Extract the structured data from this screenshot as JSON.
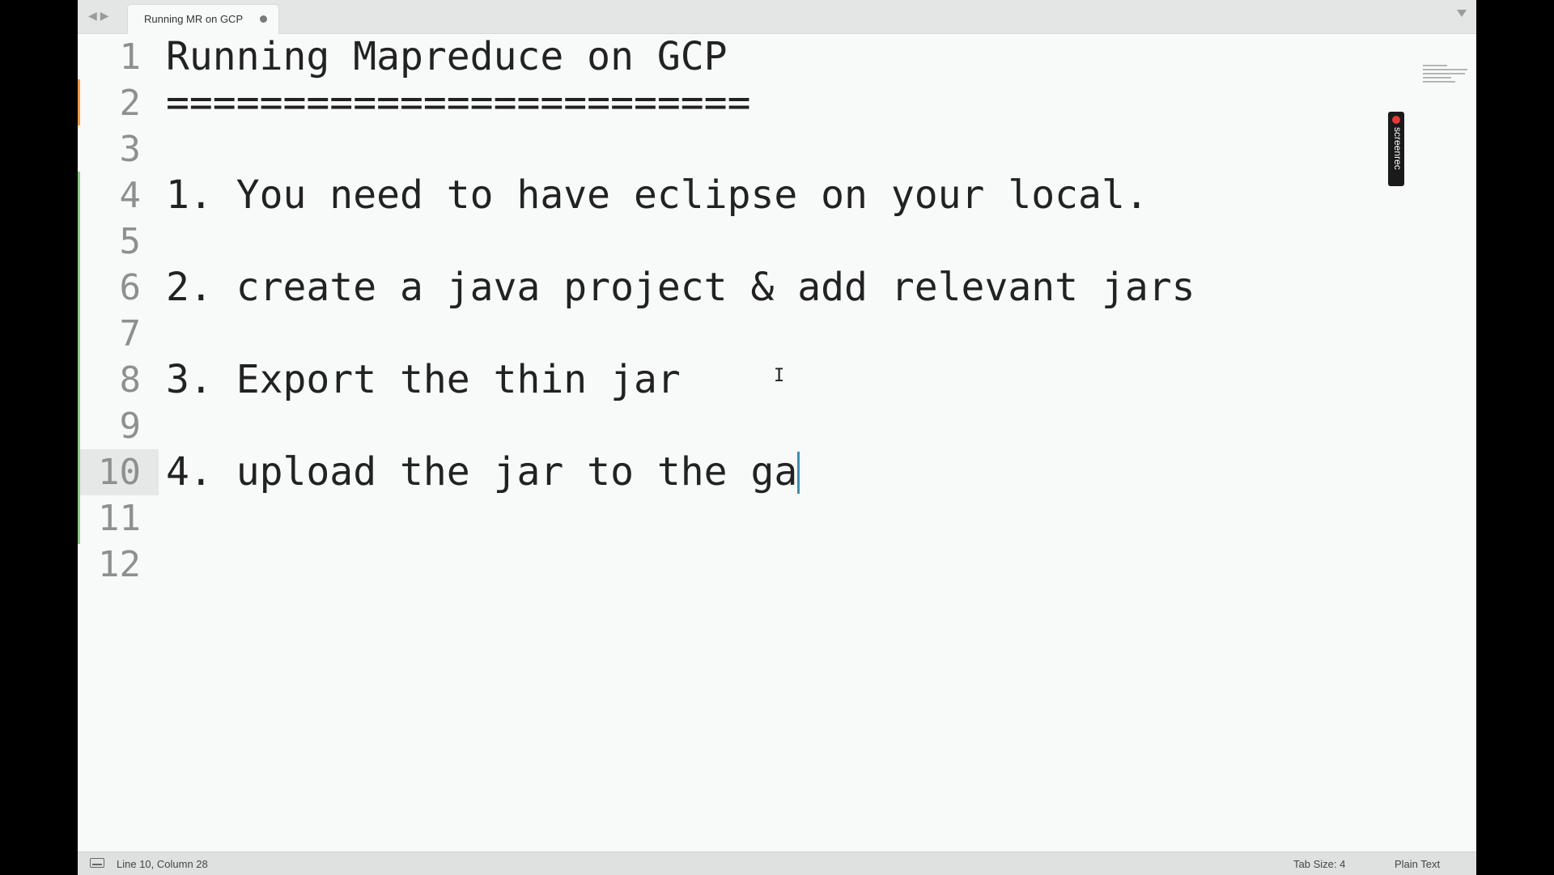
{
  "tab": {
    "title": "Running MR on GCP",
    "dirty": true
  },
  "editor": {
    "lines": [
      {
        "num": "1",
        "text": "Running Mapreduce on GCP"
      },
      {
        "num": "2",
        "text": "========================="
      },
      {
        "num": "3",
        "text": ""
      },
      {
        "num": "4",
        "text": "1. You need to have eclipse on your local."
      },
      {
        "num": "5",
        "text": ""
      },
      {
        "num": "6",
        "text": "2. create a java project & add relevant jars"
      },
      {
        "num": "7",
        "text": ""
      },
      {
        "num": "8",
        "text": "3. Export the thin jar"
      },
      {
        "num": "9",
        "text": ""
      },
      {
        "num": "10",
        "text": "4. upload the jar to the ga"
      },
      {
        "num": "11",
        "text": ""
      },
      {
        "num": "12",
        "text": ""
      }
    ],
    "current_line": 10
  },
  "overlay": {
    "screenrec_label": "screenrec"
  },
  "status": {
    "position": "Line 10, Column 28",
    "tab_size": "Tab Size: 4",
    "syntax": "Plain Text"
  },
  "colors": {
    "caret": "#3e8fb0",
    "modified_gutter": "#f29e4c",
    "added_gutter": "#8ccc8c"
  },
  "icons": {
    "nav": "left-right-arrows-icon",
    "tab_dirty": "unsaved-dot-icon",
    "tab_menu": "chevron-down-icon",
    "status_panel": "panel-toggle-icon",
    "text_cursor": "i-beam-cursor-icon"
  }
}
